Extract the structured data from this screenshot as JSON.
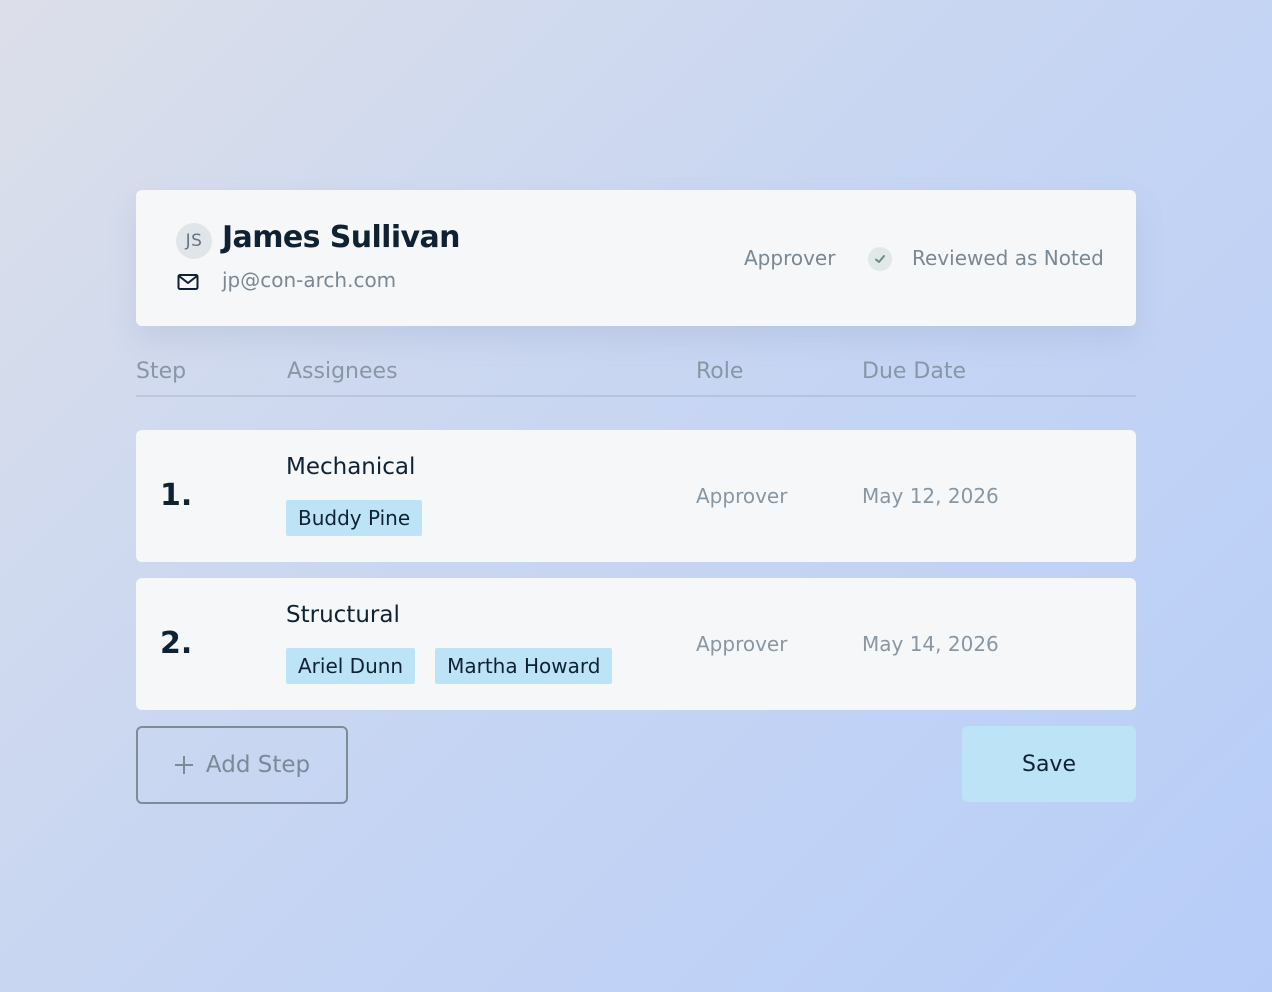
{
  "approver_card": {
    "initials": "JS",
    "name": "James Sullivan",
    "email": "jp@con-arch.com",
    "role": "Approver",
    "status": "Reviewed as Noted"
  },
  "columns": {
    "step": "Step",
    "assignees": "Assignees",
    "role": "Role",
    "due_date": "Due Date"
  },
  "steps": [
    {
      "number": "1.",
      "name": "Mechanical",
      "assignees": [
        "Buddy Pine"
      ],
      "role": "Approver",
      "due_date": "May 12, 2026"
    },
    {
      "number": "2.",
      "name": "Structural",
      "assignees": [
        "Ariel Dunn",
        "Martha Howard"
      ],
      "role": "Approver",
      "due_date": "May 14, 2026"
    }
  ],
  "actions": {
    "add_step_label": "Add Step",
    "save_label": "Save"
  },
  "colors": {
    "chip": "#bde3f7",
    "text_primary": "#0f2233",
    "text_muted": "#788894"
  },
  "icons": {
    "mail": "mail-icon",
    "status": "check-icon",
    "add": "plus-icon"
  }
}
